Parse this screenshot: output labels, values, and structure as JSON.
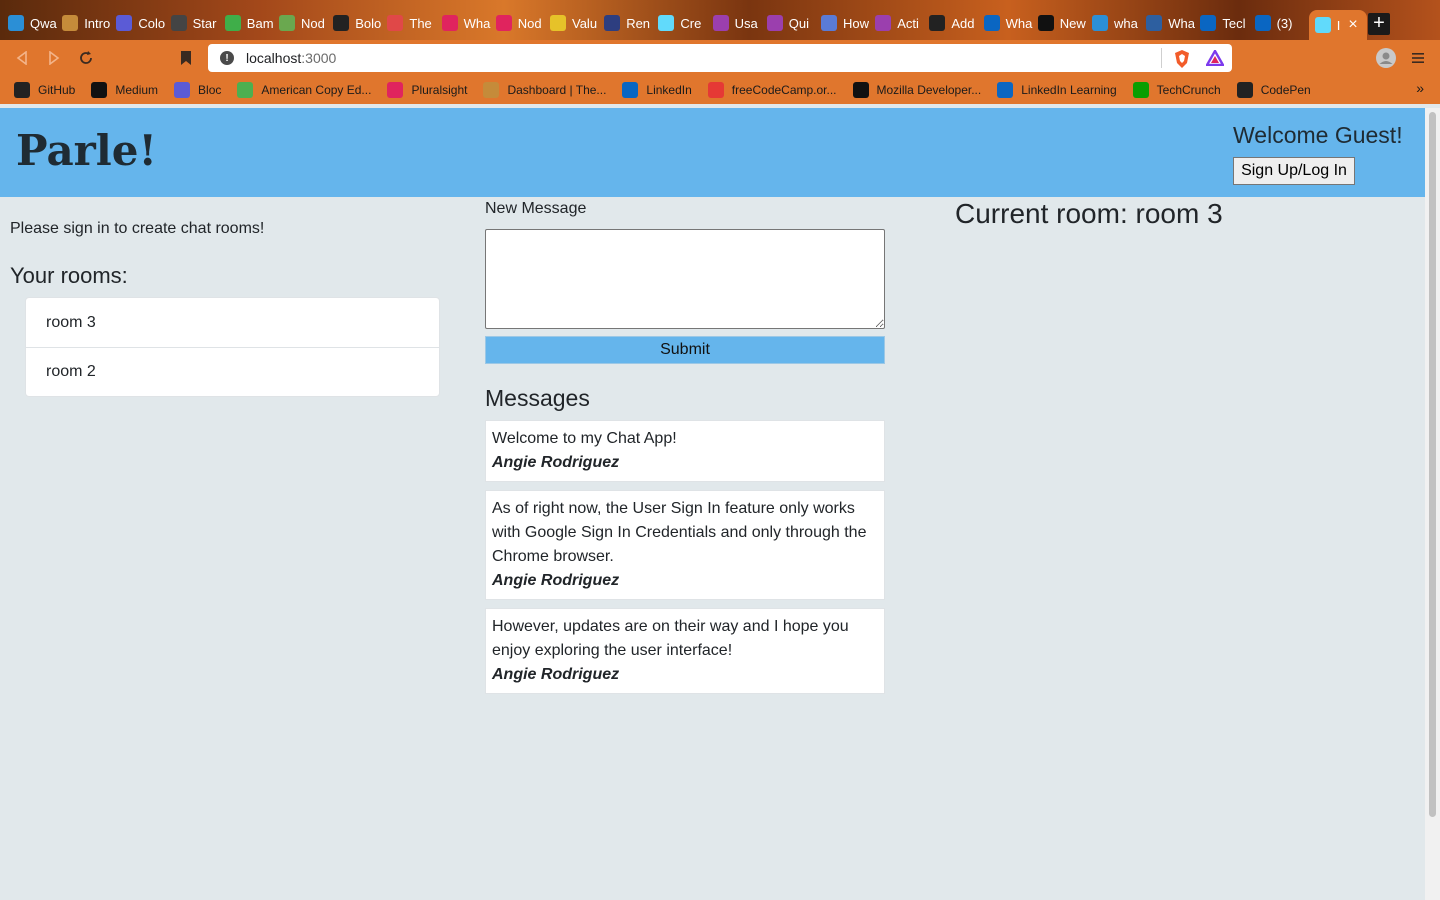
{
  "browser": {
    "tabs": [
      {
        "label": "Qwa",
        "icon": "q-icon",
        "color": "#2b8fd6"
      },
      {
        "label": "Intro",
        "icon": "bear-icon",
        "color": "#c58b3a"
      },
      {
        "label": "Colo",
        "icon": "bloc-b-icon",
        "color": "#5b5bd6"
      },
      {
        "label": "Star",
        "icon": "peace-icon",
        "color": "#444444"
      },
      {
        "label": "Bam",
        "icon": "leaf-icon",
        "color": "#3fae49"
      },
      {
        "label": "Nod",
        "icon": "graph-icon",
        "color": "#6aa84f"
      },
      {
        "label": "Bolo",
        "icon": "wp-icon",
        "color": "#222222"
      },
      {
        "label": "The",
        "icon": "speech-icon",
        "color": "#e04848"
      },
      {
        "label": "Wha",
        "icon": "play-icon",
        "color": "#e0245e"
      },
      {
        "label": "Nod",
        "icon": "play-icon",
        "color": "#e0245e"
      },
      {
        "label": "Valu",
        "icon": "js-icon",
        "color": "#e6c229"
      },
      {
        "label": "Ren",
        "icon": "r-icon",
        "color": "#2d3e80"
      },
      {
        "label": "Cre",
        "icon": "react-icon",
        "color": "#61dafb"
      },
      {
        "label": "Usa",
        "icon": "graphql-icon",
        "color": "#9b3fae"
      },
      {
        "label": "Qui",
        "icon": "graphql-icon",
        "color": "#9b3fae"
      },
      {
        "label": "How",
        "icon": "dc-icon",
        "color": "#5a7bd6"
      },
      {
        "label": "Acti",
        "icon": "graphql-icon",
        "color": "#9b3fae"
      },
      {
        "label": "Add",
        "icon": "github-icon",
        "color": "#222222"
      },
      {
        "label": "Wha",
        "icon": "linkedin-learning-icon",
        "color": "#0a66c2"
      },
      {
        "label": "New",
        "icon": "medium-icon",
        "color": "#111111"
      },
      {
        "label": "wha",
        "icon": "q-icon",
        "color": "#2b8fd6"
      },
      {
        "label": "Wha",
        "icon": "terminal-icon",
        "color": "#2d5fa0"
      },
      {
        "label": "Tecl",
        "icon": "linkedin-learning-icon",
        "color": "#0a66c2"
      },
      {
        "label": "(3)",
        "icon": "linkedin-icon",
        "color": "#0a66c2"
      },
      {
        "label": "I",
        "icon": "react-icon",
        "color": "#61dafb"
      }
    ],
    "url_host": "localhost",
    "url_port": ":3000",
    "bookmarks": [
      {
        "label": "GitHub",
        "icon": "github-icon",
        "color": "#222222"
      },
      {
        "label": "Medium",
        "icon": "medium-icon",
        "color": "#111111"
      },
      {
        "label": "Bloc",
        "icon": "bloc-b-icon",
        "color": "#5b5bd6"
      },
      {
        "label": "American Copy Ed...",
        "icon": "aces-icon",
        "color": "#4caf50"
      },
      {
        "label": "Pluralsight",
        "icon": "pluralsight-icon",
        "color": "#e0245e"
      },
      {
        "label": "Dashboard | The...",
        "icon": "bear-icon",
        "color": "#c58b3a"
      },
      {
        "label": "LinkedIn",
        "icon": "linkedin-icon",
        "color": "#0a66c2"
      },
      {
        "label": "freeCodeCamp.or...",
        "icon": "youtube-icon",
        "color": "#e53935"
      },
      {
        "label": "Mozilla Developer...",
        "icon": "mdn-icon",
        "color": "#111111"
      },
      {
        "label": "LinkedIn Learning",
        "icon": "linkedin-learning-icon",
        "color": "#0a66c2"
      },
      {
        "label": "TechCrunch",
        "icon": "techcrunch-icon",
        "color": "#0a9e01"
      },
      {
        "label": "CodePen",
        "icon": "codepen-icon",
        "color": "#222222"
      }
    ]
  },
  "header": {
    "title": "Parle!",
    "welcome": "Welcome Guest!",
    "signup_label": "Sign Up/Log In"
  },
  "sidebar": {
    "signin_note": "Please sign in to create chat rooms!",
    "rooms_heading": "Your rooms:",
    "rooms": [
      "room 3",
      "room 2"
    ]
  },
  "composer": {
    "label": "New Message",
    "submit_label": "Submit"
  },
  "messages": {
    "heading": "Messages",
    "items": [
      {
        "text": "Welcome to my Chat App!",
        "author": "Angie Rodriguez"
      },
      {
        "text": "As of right now, the User Sign In feature only works with Google Sign In Credentials and only through the Chrome browser.",
        "author": "Angie Rodriguez"
      },
      {
        "text": "However, updates are on their way and I hope you enjoy exploring the user interface!",
        "author": "Angie Rodriguez"
      }
    ]
  },
  "current_room": "Current room: room 3",
  "colors": {
    "header_bg": "#65b5ec",
    "page_bg": "#e1e8eb",
    "browser_accent": "#e0762d"
  }
}
